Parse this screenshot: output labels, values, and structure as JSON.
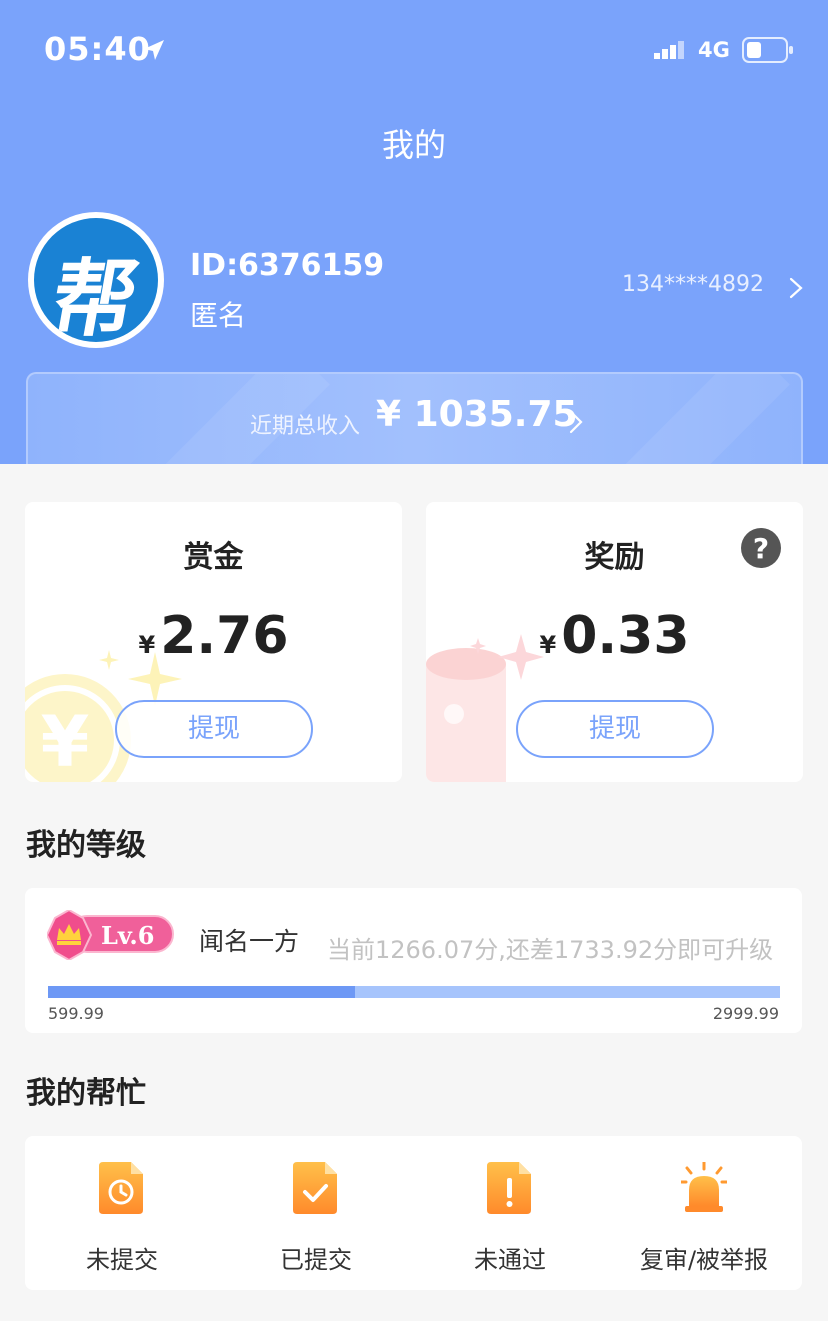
{
  "status_bar": {
    "time": "05:40",
    "network": "4G"
  },
  "nav": {
    "title": "我的"
  },
  "profile": {
    "avatar_char": "帮",
    "id": "ID:6376159",
    "name": "匿名",
    "phone": "134****4892"
  },
  "income": {
    "label": "近期总收入",
    "value": "¥ 1035.75"
  },
  "bounty": {
    "title": "赏金",
    "currency": "¥",
    "amount": "2.76",
    "withdraw_label": "提现"
  },
  "reward": {
    "title": "奖励",
    "currency": "¥",
    "amount": "0.33",
    "withdraw_label": "提现"
  },
  "level": {
    "section_title": "我的等级",
    "badge": "Lv.6",
    "name": "闻名一方",
    "progress_text": "当前1266.07分,还差1733.92分即可升级",
    "range_min": "599.99",
    "range_max": "2999.99",
    "progress_fraction": 0.42
  },
  "help": {
    "section_title": "我的帮忙",
    "items": [
      {
        "label": "未提交",
        "icon": "clock-document-icon"
      },
      {
        "label": "已提交",
        "icon": "check-document-icon"
      },
      {
        "label": "未通过",
        "icon": "exclamation-document-icon"
      },
      {
        "label": "复审/被举报",
        "icon": "alarm-siren-icon"
      }
    ]
  },
  "colors": {
    "header_bg": "#7aa3fb",
    "accent": "#7aa3fb",
    "icon_orange": "#ffa63a",
    "level_badge_pink": "#f0609a"
  }
}
